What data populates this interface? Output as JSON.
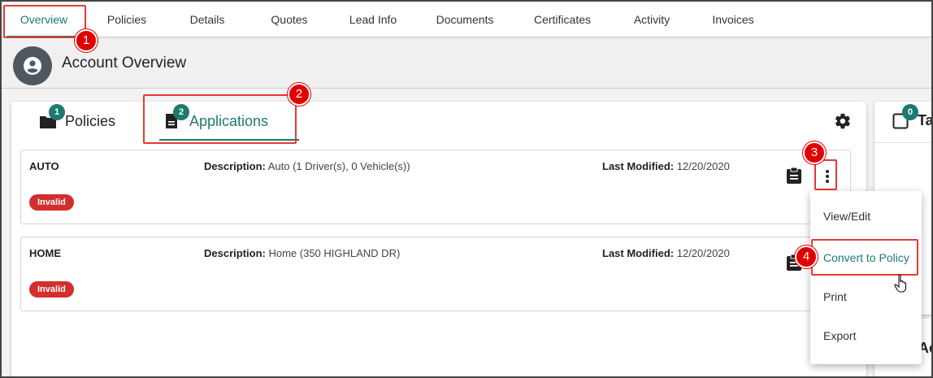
{
  "top_nav": {
    "tabs": [
      {
        "label": "Overview",
        "active": true
      },
      {
        "label": "Policies"
      },
      {
        "label": "Details"
      },
      {
        "label": "Quotes"
      },
      {
        "label": "Lead Info"
      },
      {
        "label": "Documents"
      },
      {
        "label": "Certificates"
      },
      {
        "label": "Activity"
      },
      {
        "label": "Invoices"
      }
    ]
  },
  "account": {
    "title": "Account Overview",
    "icon": "account-circle-icon"
  },
  "card": {
    "tabs": [
      {
        "label": "Policies",
        "badge": "1",
        "icon": "folder-icon"
      },
      {
        "label": "Applications",
        "badge": "2",
        "icon": "document-icon",
        "active": true
      }
    ],
    "settings_icon": "gear-icon"
  },
  "applications": [
    {
      "type": "AUTO",
      "description_label": "Description:",
      "description": "Auto (1 Driver(s), 0 Vehicle(s))",
      "modified_label": "Last Modified:",
      "modified": "12/20/2020",
      "status": "Invalid"
    },
    {
      "type": "HOME",
      "description_label": "Description:",
      "description": "Home (350 HIGHLAND DR)",
      "modified_label": "Last Modified:",
      "modified": "12/20/2020",
      "status": "Invalid"
    }
  ],
  "side_panel": {
    "badge": "0",
    "label_fragment": "Ta",
    "label_fragment_2": "Ac"
  },
  "menu": {
    "items": [
      "View/Edit",
      "Convert to Policy",
      "Print",
      "Export"
    ],
    "highlighted": "Convert to Policy"
  },
  "steps": [
    "1",
    "2",
    "3",
    "4"
  ],
  "colors": {
    "accent": "#1e7a6f",
    "invalid": "#d32f2f",
    "highlight": "#e53935"
  }
}
